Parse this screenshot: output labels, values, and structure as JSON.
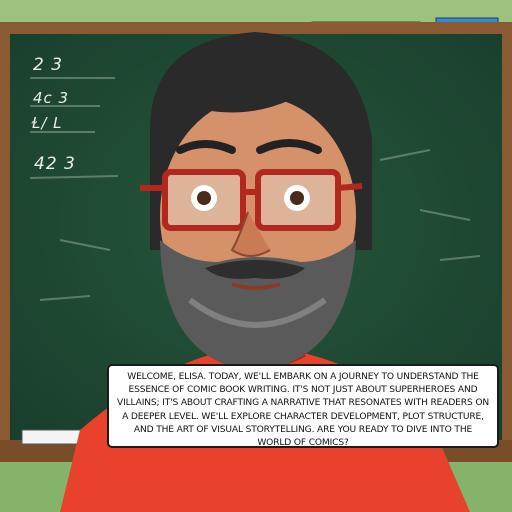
{
  "chalkboard": {
    "line1": "2 3",
    "line2": "4c 3",
    "line3": "Ɫ/ L",
    "line4": "42 3"
  },
  "caption": {
    "text": "Welcome, Elisa. Today, we'll embark on a journey to understand the essence of comic book writing. It's not just about superheroes and villains; it's about crafting a narrative that resonates with readers on a deeper level. We'll explore character development, plot structure, and the art of visual storytelling. Are you ready to dive into the world of comics?"
  },
  "colors": {
    "wall": "#86b36a",
    "board": "#1f4a33",
    "frame": "#8a5a32",
    "shirt": "#e8422c",
    "hair": "#2a2a2a",
    "skin": "#d4916a",
    "glasses": "#b3281e"
  }
}
